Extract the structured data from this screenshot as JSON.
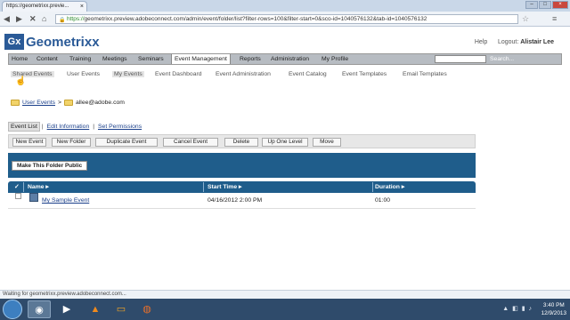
{
  "browser": {
    "tab_title": "https://geometrixx.previe...",
    "tab_close": "×",
    "url_prefix": "https://",
    "url_rest": "geometrixx.preview.adobeconnect.com/admin/event/folder/list?filter-rows=100&filter-start=0&sco-id=1040576132&tab-id=1040576132",
    "status_text": "Waiting for geometrixx.preview.adobeconnect.com..."
  },
  "header": {
    "logo_mark": "Gx",
    "logo_name": "Geometrixx",
    "help": "Help",
    "logout_label": "Logout:",
    "user": "Alistair Lee"
  },
  "mainnav": {
    "items": [
      "Home",
      "Content",
      "Training",
      "Meetings",
      "Seminars",
      "Event Management",
      "Reports",
      "Administration",
      "My Profile"
    ],
    "search_label": "Search..."
  },
  "subnav": {
    "items": [
      "Shared Events",
      "User Events",
      "My Events",
      "Event Dashboard",
      "Event Administration",
      "Event Catalog",
      "Event Templates",
      "Email Templates"
    ]
  },
  "breadcrumb": {
    "root": "User Events",
    "sep": ">",
    "current": "allee@adobe.com"
  },
  "tabs": {
    "event_list": "Event List",
    "edit_info": "Edit Information",
    "set_permissions": "Set Permissions",
    "sep": "|"
  },
  "toolbar": {
    "buttons": [
      "New Event",
      "New Folder",
      "Duplicate Event",
      "Cancel Event",
      "Delete",
      "Up One Level",
      "Move"
    ]
  },
  "public_button": "Make This Folder Public",
  "table": {
    "check_glyph": "✓",
    "headers": [
      "Name",
      "Start Time",
      "Duration"
    ],
    "sort_glyph": "▸",
    "rows": [
      {
        "name": "My Sample Event",
        "start": "04/16/2012 2:00 PM",
        "duration": "01:00"
      }
    ]
  },
  "taskbar": {
    "time": "3:40 PM",
    "date": "12/9/2013"
  }
}
